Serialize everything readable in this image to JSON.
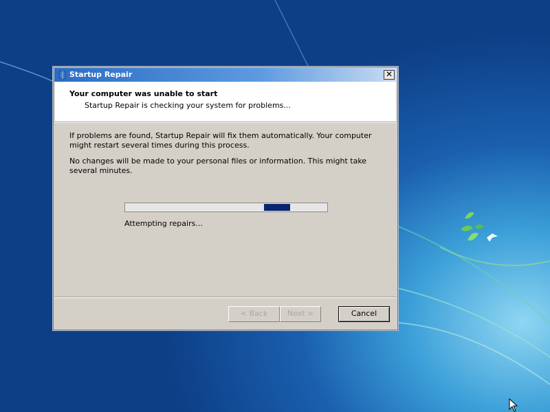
{
  "dialog": {
    "title": "Startup Repair",
    "close_label": "✕",
    "header_title": "Your computer was unable to start",
    "header_subtitle": "Startup Repair is checking your system for problems...",
    "paragraph1": "If problems are found, Startup Repair will fix them automatically. Your computer might restart several times during this process.",
    "paragraph2": "No changes will be made to your personal files or information. This might take several minutes.",
    "status": "Attempting repairs...",
    "progress": {
      "style": "marquee",
      "indicator_position": 0.79
    },
    "buttons": {
      "back": "< Back",
      "next": "Next >",
      "cancel": "Cancel"
    }
  },
  "colors": {
    "title_bar": "#2b6cc4",
    "progress_fill": "#0b2470",
    "dialog_bg": "#d4d0c8"
  }
}
